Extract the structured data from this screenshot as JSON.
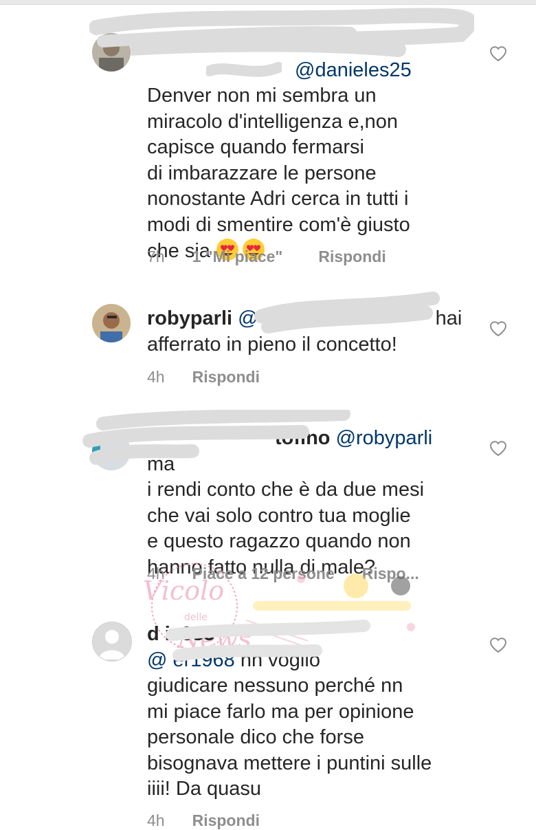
{
  "comments": [
    {
      "id": "c1",
      "username": "",
      "mention": "@danieles25",
      "text": "Denver non mi sembra un\nmiracolo d'intelligenza  e,non\ncapisce quando fermarsi\ndi imbarazzare le persone\nnonostante Adri cerca in tutti i\nmodi di  smentire com'è giusto\nche sia",
      "emoji": "smiling-face-with-heart-eyes x2",
      "time": "7h",
      "likes": "1 \"Mi piace\"",
      "reply": "Rispondi"
    },
    {
      "id": "c2",
      "username": "robyparli",
      "mention": "@",
      "text": "hai\nafferrato in pieno il concetto!",
      "time": "4h",
      "reply": "Rispondi"
    },
    {
      "id": "c3",
      "username": "tofino",
      "mention": "@robyparli",
      "text": "ma\ni rendi conto che è da due mesi\nche vai solo contro tua moglie\ne questo ragazzo quando non\nhanno fatto nulla di male?",
      "time": "4h",
      "likes": "Piace a 12 persone",
      "reply": "Rispo..."
    },
    {
      "id": "c4",
      "username": "d                ic083",
      "mention": "@                er1968",
      "text": "nn voglio\ngiudicare nessuno perché nn\nmi piace farlo ma per opinione\npersonale dico che forse\nbisognava mettere i puntini sulle\niiii! Da quasu",
      "time": "4h",
      "reply": "Rispondi"
    }
  ],
  "watermark": {
    "line1": "Vicolo",
    "line2": "delle",
    "line3": "News"
  },
  "colors": {
    "text": "#262626",
    "mention": "#00376b",
    "meta": "#8e8e8e",
    "scribble": "#d9d9d9",
    "watermark": "#e98fb3"
  }
}
